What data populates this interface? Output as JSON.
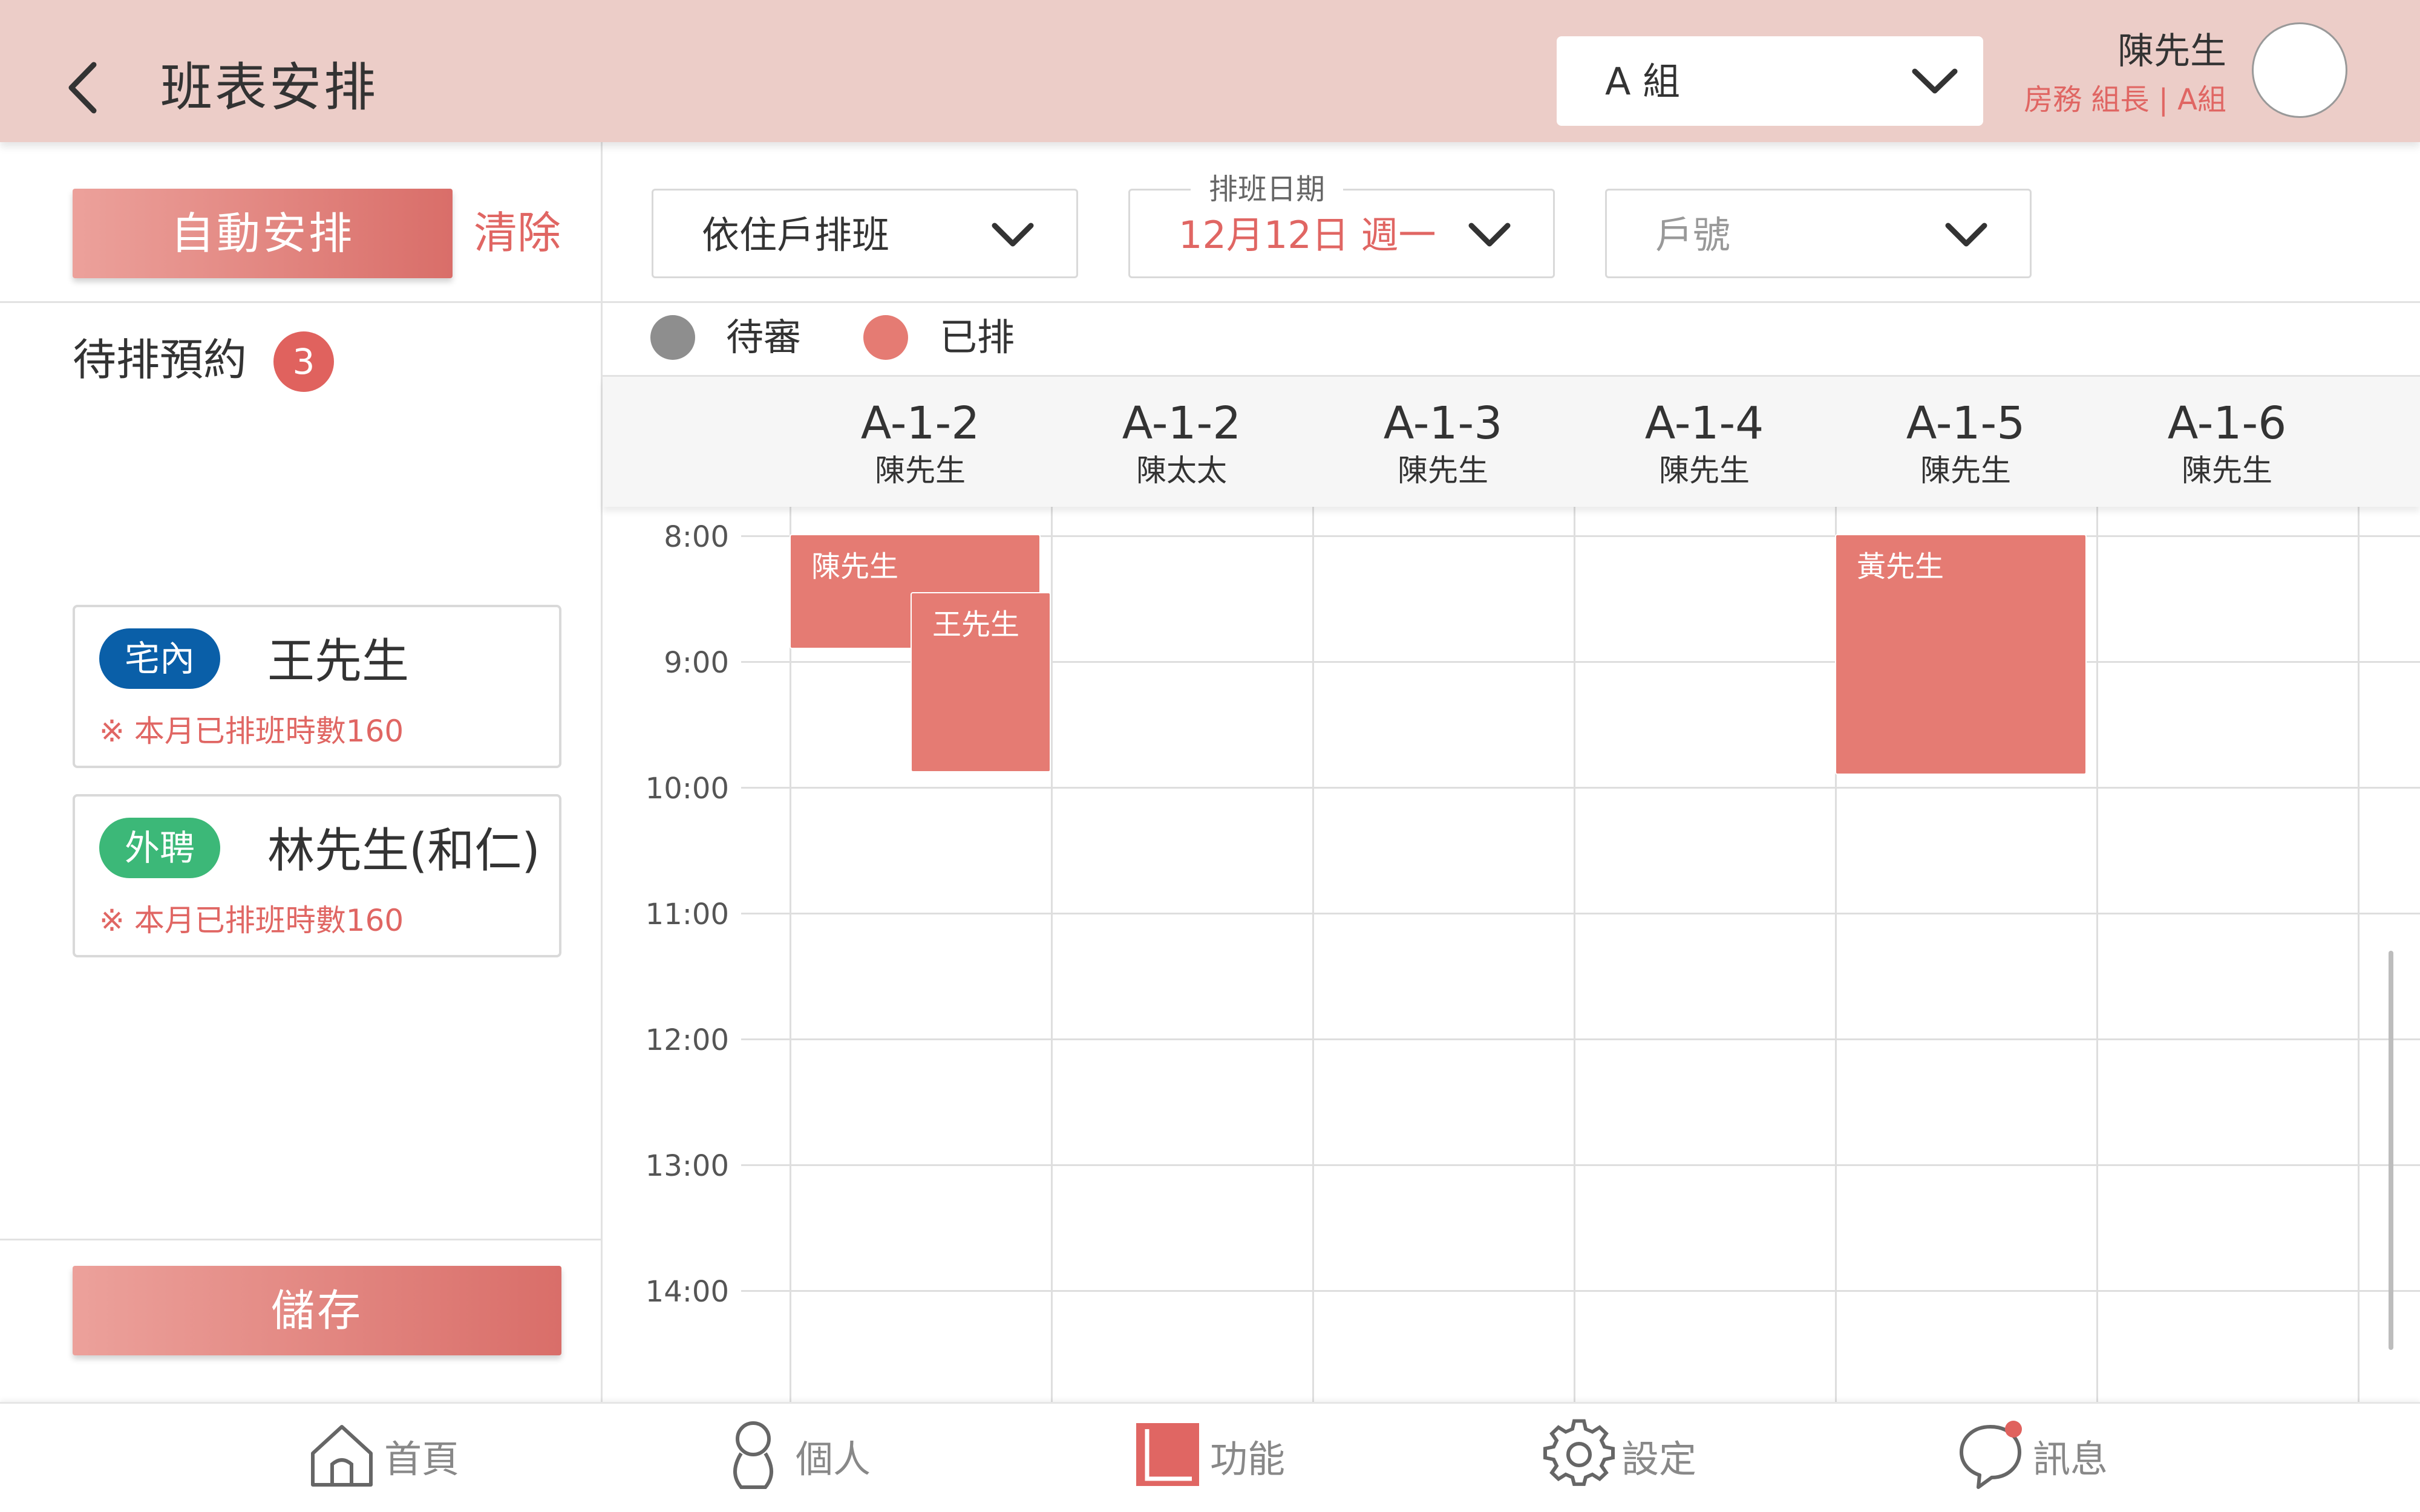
{
  "header": {
    "title": "班表安排",
    "group_select": "A 組",
    "user_name": "陳先生",
    "user_role": "房務 組長 | A組"
  },
  "left": {
    "auto_button": "自動安排",
    "clear_button": "清除",
    "pending_title": "待排預約",
    "pending_count": "3",
    "cards": [
      {
        "tag": "宅內",
        "tag_color": "#0a5fa8",
        "name": "王先生",
        "note": "※ 本月已排班時數160"
      },
      {
        "tag": "外聘",
        "tag_color": "#3cb878",
        "name": "林先生(和仁)",
        "note": "※ 本月已排班時數160"
      }
    ],
    "save_button": "儲存"
  },
  "filters": {
    "mode": "依住戶排班",
    "date_label": "排班日期",
    "date_value": "12月12日 週一",
    "unit_placeholder": "戶號"
  },
  "legend": {
    "pending_label": "待審",
    "pending_color": "#8e8e8e",
    "scheduled_label": "已排",
    "scheduled_color": "#e57b73"
  },
  "columns": [
    {
      "unit": "A-1-2",
      "owner": "陳先生"
    },
    {
      "unit": "A-1-2",
      "owner": "陳太太"
    },
    {
      "unit": "A-1-3",
      "owner": "陳先生"
    },
    {
      "unit": "A-1-4",
      "owner": "陳先生"
    },
    {
      "unit": "A-1-5",
      "owner": "陳先生"
    },
    {
      "unit": "A-1-6",
      "owner": "陳先生"
    }
  ],
  "times": [
    "8:00",
    "9:00",
    "10:00",
    "11:00",
    "12:00",
    "13:00",
    "14:00"
  ],
  "events": [
    {
      "name": "陳先生",
      "unit": "A-1-2",
      "owner": "陳先生",
      "status": "已排"
    },
    {
      "name": "王先生",
      "unit": "A-1-2",
      "owner": "陳先生",
      "status": "已排"
    },
    {
      "name": "黃先生",
      "unit": "A-1-5",
      "owner": "陳先生",
      "status": "已排"
    }
  ],
  "nav": [
    {
      "label": "首頁",
      "icon": "home-icon",
      "active": false
    },
    {
      "label": "個人",
      "icon": "person-icon",
      "active": false
    },
    {
      "label": "功能",
      "icon": "function-icon",
      "active": true
    },
    {
      "label": "設定",
      "icon": "gear-icon",
      "active": false
    },
    {
      "label": "訊息",
      "icon": "message-icon",
      "active": false
    }
  ],
  "colors": {
    "header_bg": "#eccdc8",
    "accent": "#e06663",
    "event": "#e57b73"
  }
}
